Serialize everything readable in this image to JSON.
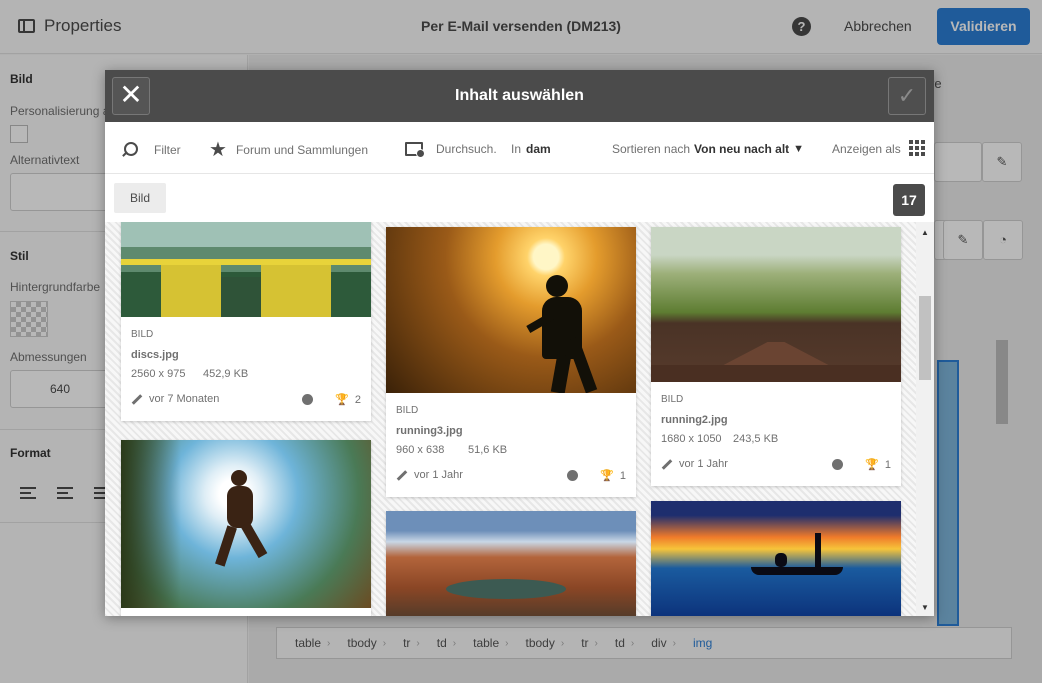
{
  "app": {
    "properties_label": "Properties",
    "window_title": "Per E-Mail versenden (DM213)",
    "help_label": "?",
    "cancel_label": "Abbrechen",
    "validate_label": "Validieren"
  },
  "sidebar": {
    "image_heading": "Bild",
    "personalization_label": "Personalisierung a",
    "alt_text_label": "Alternativtext",
    "style_heading": "Stil",
    "bgcolor_label": "Hintergrundfarbe",
    "dimensions_label": "Abmessungen",
    "width_value": "640",
    "format_heading": "Format"
  },
  "right_area": {
    "tab_text": "re"
  },
  "breadcrumb": [
    "table",
    "tbody",
    "tr",
    "td",
    "table",
    "tbody",
    "tr",
    "td",
    "div",
    "img"
  ],
  "modal": {
    "title": "Inhalt auswählen",
    "close_label": "✕",
    "confirm_label": "✓",
    "toolbar": {
      "filter_label": "Filter",
      "collections_label": "Forum und Sammlungen",
      "browse_label": "Durchsuch.",
      "in_label": "In",
      "in_value": "dam",
      "sort_label": "Sortieren nach",
      "sort_value": "Von neu nach alt",
      "view_label": "Anzeigen als"
    },
    "filter_tag": "Bild",
    "result_count": "17",
    "cards": [
      {
        "type": "BILD",
        "name": "discs.jpg",
        "dims": "2560 x 975",
        "size": "452,9 KB",
        "date": "vor 7 Monaten",
        "trophies": "2",
        "icon": "discs"
      },
      {
        "type": "BILD",
        "name": "running3.jpg",
        "dims": "960 x 638",
        "size": "51,6 KB",
        "date": "vor 1 Jahr",
        "trophies": "1",
        "icon": "runner-sunset"
      },
      {
        "type": "BILD",
        "name": "running2.jpg",
        "dims": "1680 x 1050",
        "size": "243,5 KB",
        "date": "vor 1 Jahr",
        "trophies": "1",
        "icon": "running-track"
      }
    ]
  },
  "colors": {
    "accent": "#2b7fd6",
    "header_dark": "#4b4b4b"
  }
}
